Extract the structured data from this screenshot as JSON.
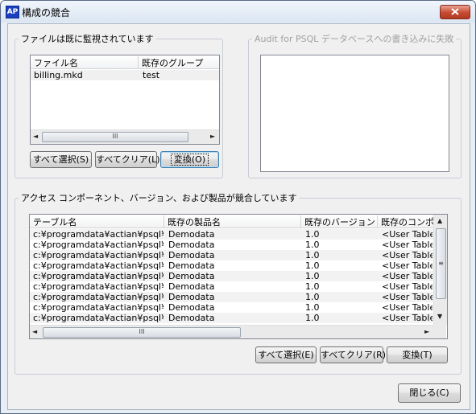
{
  "window": {
    "icon_text": "AP",
    "title": "構成の競合"
  },
  "monitored": {
    "legend": "ファイルは既に監視されています",
    "columns": [
      "ファイル名",
      "既存のグループ"
    ],
    "rows": [
      {
        "file": "billing.mkd",
        "group": "test"
      }
    ],
    "buttons": {
      "select_all": "すべて選択(S)",
      "clear_all": "すべてクリア(L)",
      "convert": "変換(O)"
    }
  },
  "audit": {
    "legend": "Audit for PSQL データベースへの書き込みに失敗"
  },
  "conflicts": {
    "legend": "アクセス コンポーネント、バージョン、および製品が競合しています",
    "columns": [
      "テーブル名",
      "既存の製品名",
      "既存のバージョン",
      "既存のコンポー"
    ],
    "rows": [
      {
        "table": "c:¥programdata¥actian¥psql¥d...",
        "product": "Demodata",
        "version": "1.0",
        "component": "<User Tables>"
      },
      {
        "table": "c:¥programdata¥actian¥psql¥d...",
        "product": "Demodata",
        "version": "1.0",
        "component": "<User Tables>"
      },
      {
        "table": "c:¥programdata¥actian¥psql¥d...",
        "product": "Demodata",
        "version": "1.0",
        "component": "<User Tables>"
      },
      {
        "table": "c:¥programdata¥actian¥psql¥d...",
        "product": "Demodata",
        "version": "1.0",
        "component": "<User Tables>"
      },
      {
        "table": "c:¥programdata¥actian¥psql¥d...",
        "product": "Demodata",
        "version": "1.0",
        "component": "<User Tables>"
      },
      {
        "table": "c:¥programdata¥actian¥psql¥d...",
        "product": "Demodata",
        "version": "1.0",
        "component": "<User Tables>"
      },
      {
        "table": "c:¥programdata¥actian¥psql¥d...",
        "product": "Demodata",
        "version": "1.0",
        "component": "<User Tables>"
      },
      {
        "table": "c:¥programdata¥actian¥psql¥d...",
        "product": "Demodata",
        "version": "1.0",
        "component": "<User Tables>"
      },
      {
        "table": "c:¥programdata¥actian¥psql¥d...",
        "product": "Demodata",
        "version": "1.0",
        "component": "<User Tables>"
      }
    ],
    "buttons": {
      "select_all": "すべて選択(E)",
      "clear_all": "すべてクリア(R)",
      "convert": "変換(T)"
    }
  },
  "footer": {
    "close": "閉じる(C)"
  },
  "scrollbar_glyphs": {
    "grip_h": "III",
    "grip_v": "≡",
    "left": "◄",
    "right": "►",
    "up": "▲",
    "down": "▼"
  }
}
